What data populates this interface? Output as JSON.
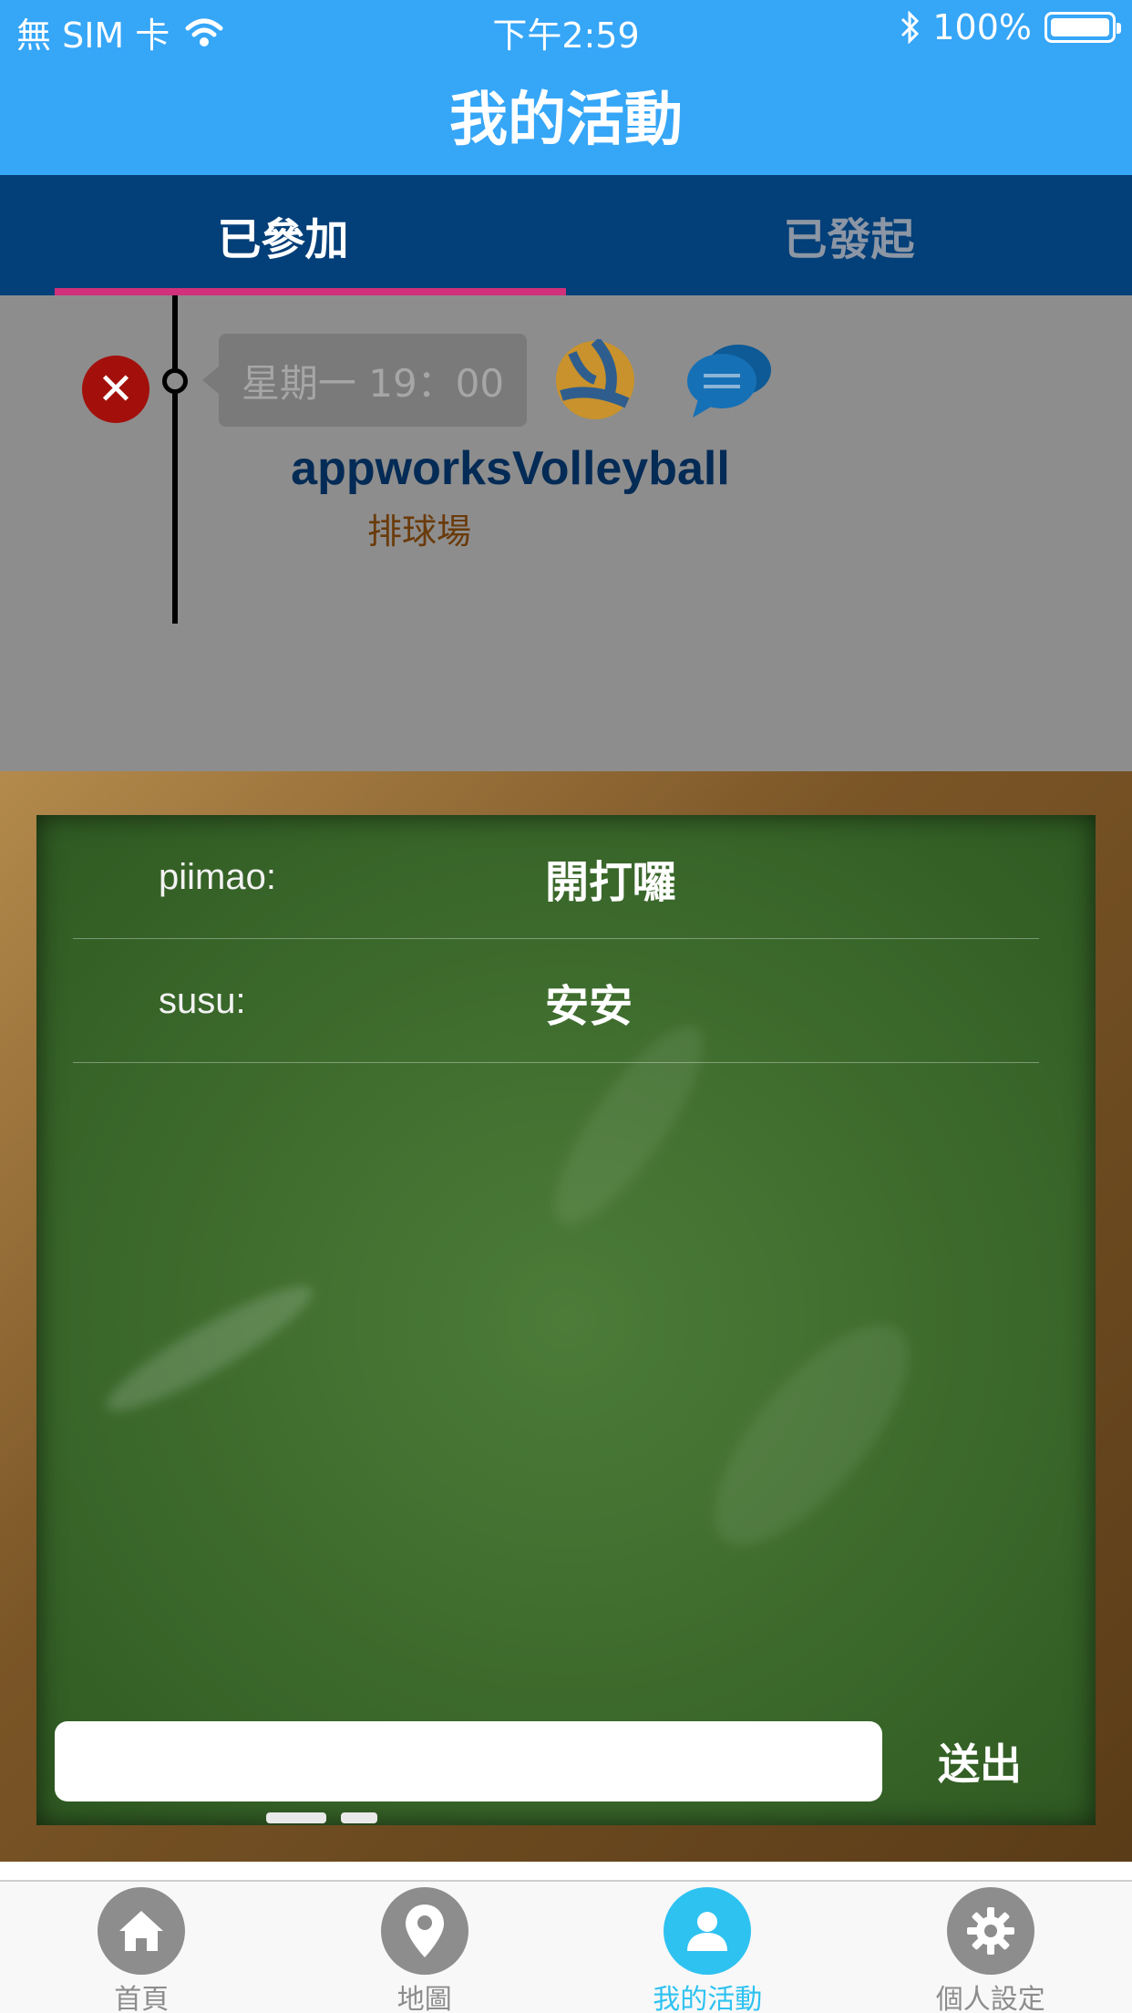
{
  "status_bar": {
    "carrier": "無 SIM 卡",
    "time": "下午2:59",
    "battery": "100%"
  },
  "nav": {
    "title": "我的活動"
  },
  "tabs": [
    {
      "label": "已參加",
      "selected": true
    },
    {
      "label": "已發起",
      "selected": false
    }
  ],
  "event": {
    "time": "星期一 19：00",
    "name": "appworksVolleyball",
    "venue": "排球場",
    "sport_icon": "volleyball-icon",
    "chat_icon": "chat-bubbles-icon",
    "cancel_icon": "close-icon"
  },
  "chat": {
    "messages": [
      {
        "user": "piimao:",
        "text": "開打囉"
      },
      {
        "user": "susu:",
        "text": "安安"
      }
    ],
    "input": {
      "value": "",
      "placeholder": ""
    },
    "send_label": "送出"
  },
  "tabbar": {
    "items": [
      {
        "label": "首頁",
        "icon": "home-icon",
        "active": false
      },
      {
        "label": "地圖",
        "icon": "map-pin-icon",
        "active": false
      },
      {
        "label": "我的活動",
        "icon": "person-icon",
        "active": true
      },
      {
        "label": "個人設定",
        "icon": "gear-icon",
        "active": false
      }
    ]
  },
  "colors": {
    "nav_blue": "#36a6f7",
    "tab_bar_dark": "#033f78",
    "tab_underline": "#d1317a",
    "active_tab_icon": "#2ec2f1",
    "chalkboard_green": "#3f6d2e"
  }
}
